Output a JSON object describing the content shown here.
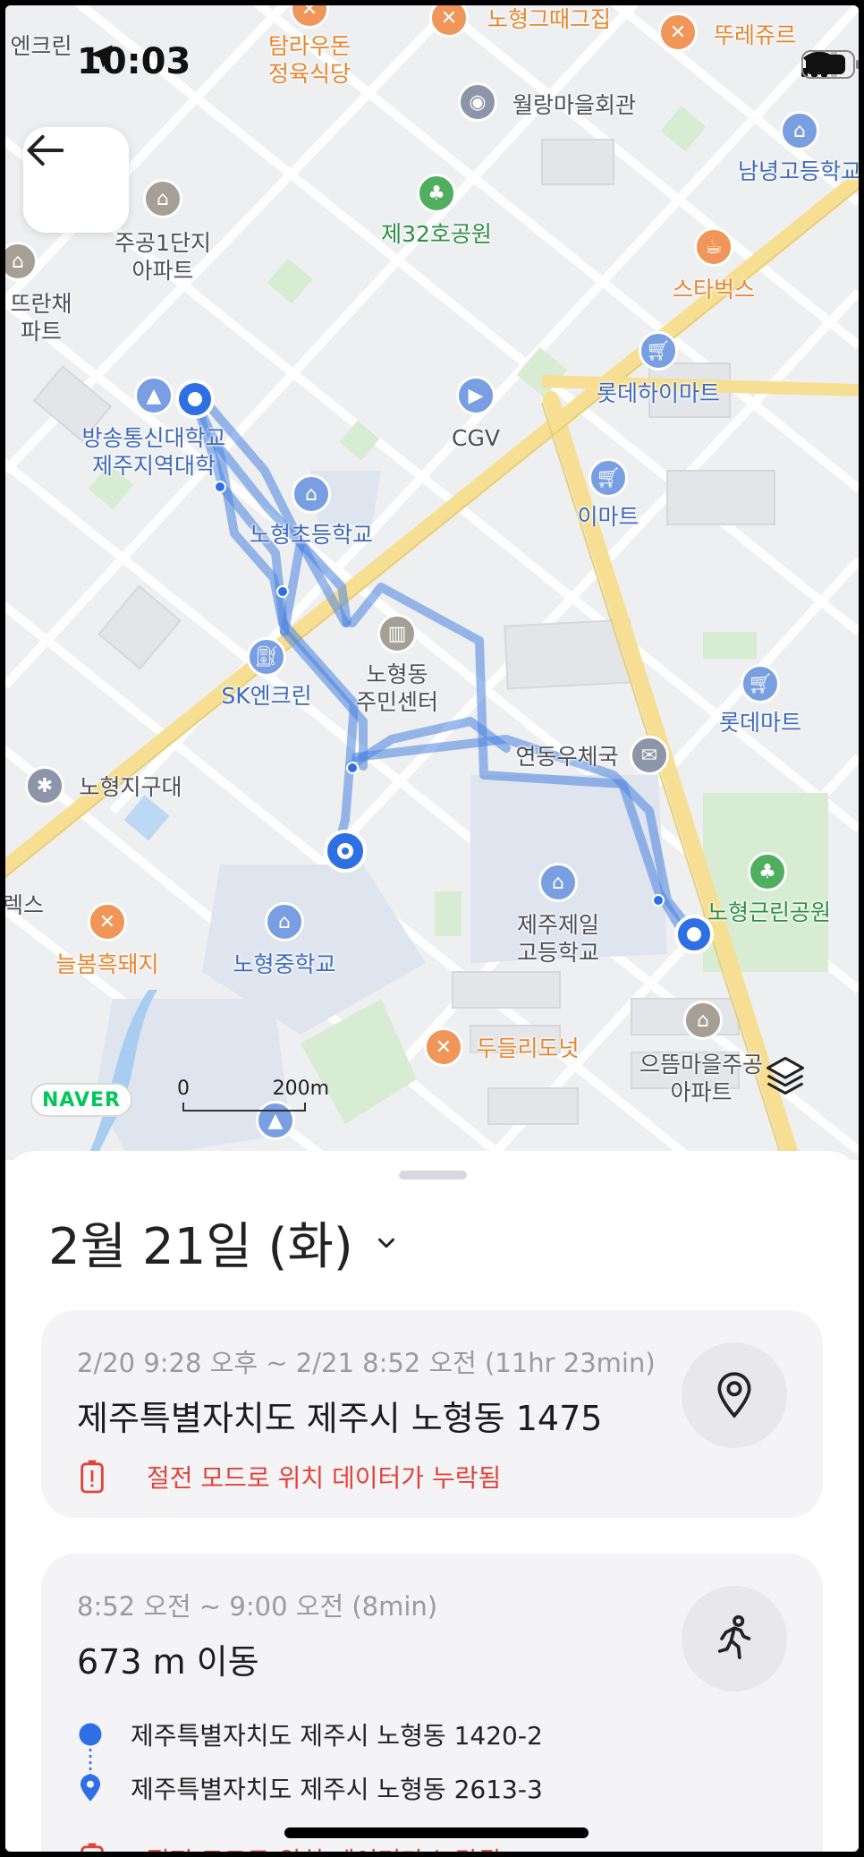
{
  "status_bar": {
    "time": "10:03"
  },
  "map": {
    "labels": {
      "encrin_top": "엔크린",
      "tamrau": "탐라우돈\n정육식당",
      "nohyeong_gaetgeurim": "노형그때그집",
      "ttureju": "뚜레쥬르",
      "wollang": "월랑마을회관",
      "namnyeong": "남녕고등학교",
      "jugong": "주공1단지\n아파트",
      "park32": "제32호공원",
      "starbucks": "스타벅스",
      "tteuran": "뜨란채\n파트",
      "lottehighmart": "롯데하이마트",
      "bangtong": "방송통신대학교\n제주지역대학",
      "cgv": "CGV",
      "emart": "이마트",
      "nohyeong_elem": "노형초등학교",
      "community": "노형동\n주민센터",
      "sk": "SK엔크린",
      "lottemart": "롯데마트",
      "post": "연동우체국",
      "police": "노형지구대",
      "hex": "렉스",
      "neulbom": "늘봄흑돼지",
      "middle": "노형중학교",
      "jeil": "제주제일\n고등학교",
      "park_near": "노형근린공원",
      "dudeul": "두들리도넛",
      "eutteum": "으뜸마을주공\n아파트"
    },
    "brand": "NAVER",
    "scale_zero": "0",
    "scale_distance": "200m"
  },
  "sheet": {
    "date_title": "2월 21일 (화)",
    "cards": [
      {
        "time_range": "2/20 9:28 오후 ~ 2/21 8:52 오전 (11hr 23min)",
        "title": "제주특별자치도 제주시 노형동 1475",
        "warning": "절전 모드로 위치 데이터가 누락됨",
        "icon": "location-pin-icon"
      },
      {
        "time_range": "8:52 오전 ~ 9:00 오전 (8min)",
        "title": "673 m 이동",
        "from": "제주특별자치도 제주시 노형동 1420-2",
        "to": "제주특별자치도 제주시 노형동 2613-3",
        "warning": "절전 모드로 위치 데이터가 누락됨",
        "icon": "walking-icon"
      }
    ]
  },
  "colors": {
    "route": "#4a84e0",
    "warning": "#e0433b",
    "accent_blue": "#2f6fe4"
  }
}
